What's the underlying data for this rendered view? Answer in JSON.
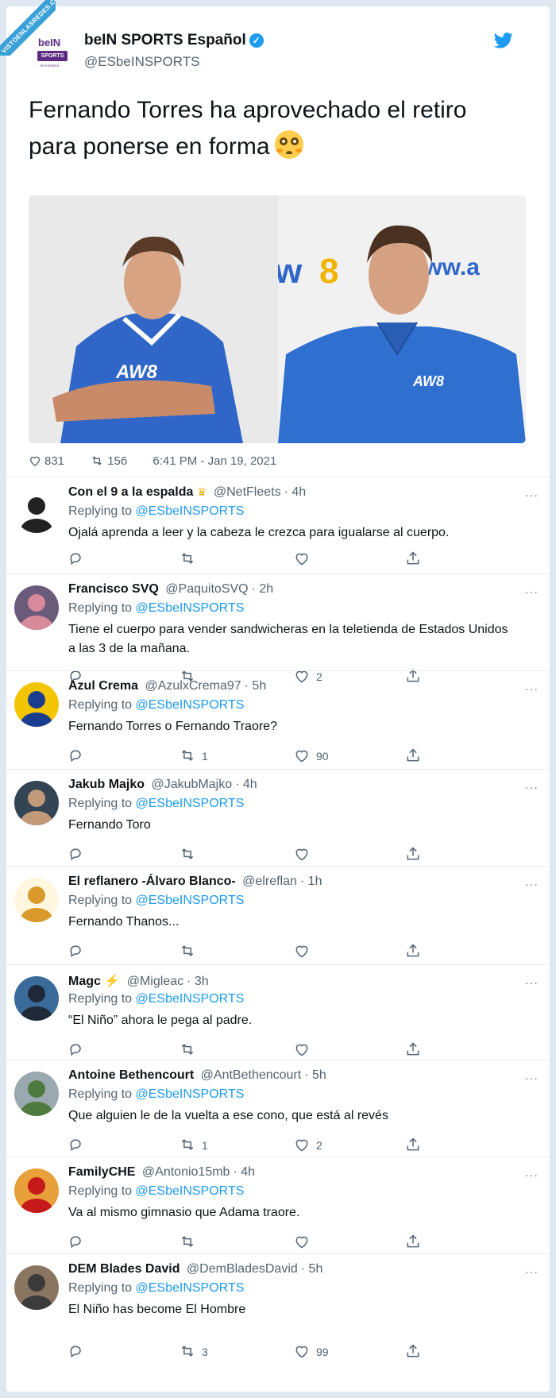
{
  "watermark": "VISTOENLASREDES.COM",
  "tweet": {
    "logo": {
      "line1": "beIN",
      "line2": "SPORTS",
      "line3": "EN ESPAÑOL"
    },
    "author_name": "beIN SPORTS Español",
    "author_handle": "@ESbeINSPORTS",
    "text": "Fernando Torres ha aprovechado el retiro para ponerse en forma",
    "emoji": "flushed-face",
    "likes": "831",
    "retweets": "156",
    "timestamp": "6:41 PM - Jan 19, 2021"
  },
  "replies": [
    {
      "name": "Con el 9 a la espalda",
      "badge": "crown",
      "handle": "@NetFleets",
      "time": "· 4h",
      "replying_label": "Replying to",
      "mention": "@ESbeINSPORTS",
      "text": "Ojalá aprenda  a leer y la cabeza le crezca para igualarse al cuerpo.",
      "retweets": "",
      "likes": ""
    },
    {
      "name": "Francisco SVQ",
      "badge": "",
      "handle": "@PaquitoSVQ",
      "time": "· 2h",
      "replying_label": "Replying to",
      "mention": "@ESbeINSPORTS",
      "text": "Tiene el cuerpo para vender sandwicheras en la teletienda de Estados Unidos a las 3 de la mañana.",
      "retweets": "",
      "likes": "2"
    },
    {
      "name": "Azul Crema",
      "badge": "",
      "handle": "@AzulxCrema97",
      "time": "· 5h",
      "replying_label": "Replying to",
      "mention": "@ESbeINSPORTS",
      "text": "Fernando Torres o Fernando Traore?",
      "retweets": "1",
      "likes": "90"
    },
    {
      "name": "Jakub Majko",
      "badge": "",
      "handle": "@JakubMajko",
      "time": "· 4h",
      "replying_label": "Replying to",
      "mention": "@ESbeINSPORTS",
      "text": "Fernando Toro",
      "retweets": "",
      "likes": ""
    },
    {
      "name": "El reflanero -Álvaro Blanco-",
      "badge": "",
      "handle": "@elreflan",
      "time": "· 1h",
      "replying_label": "Replying to",
      "mention": "@ESbeINSPORTS",
      "text": "Fernando Thanos...",
      "retweets": "",
      "likes": ""
    },
    {
      "name": "Magc",
      "badge": "bolt",
      "handle": "@Migleac",
      "time": "· 3h",
      "replying_label": "Replying to",
      "mention": "@ESbeINSPORTS",
      "text": "“El Niño” ahora le pega al padre.",
      "retweets": "",
      "likes": ""
    },
    {
      "name": "Antoine Bethencourt",
      "badge": "",
      "handle": "@AntBethencourt",
      "time": "· 5h",
      "replying_label": "Replying to",
      "mention": "@ESbeINSPORTS",
      "text": "Que alguien le de la vuelta a ese cono, que está al revés",
      "retweets": "1",
      "likes": "2"
    },
    {
      "name": "FamilyCHE",
      "badge": "",
      "handle": "@Antonio15mb",
      "time": "· 4h",
      "replying_label": "Replying to",
      "mention": "@ESbeINSPORTS",
      "text": "Va al mismo gimnasio que Adama traore.",
      "retweets": "",
      "likes": ""
    },
    {
      "name": "DEM Blades David",
      "badge": "",
      "handle": "@DemBladesDavid",
      "time": "· 5h",
      "replying_label": "Replying to",
      "mention": "@ESbeINSPORTS",
      "text": "El Niño has become El Hombre",
      "retweets": "3",
      "likes": "99"
    }
  ],
  "more_icon": "···",
  "colors": {
    "accent": "#1d9bf0",
    "brand": "#5b2b82",
    "muted": "#536471"
  }
}
